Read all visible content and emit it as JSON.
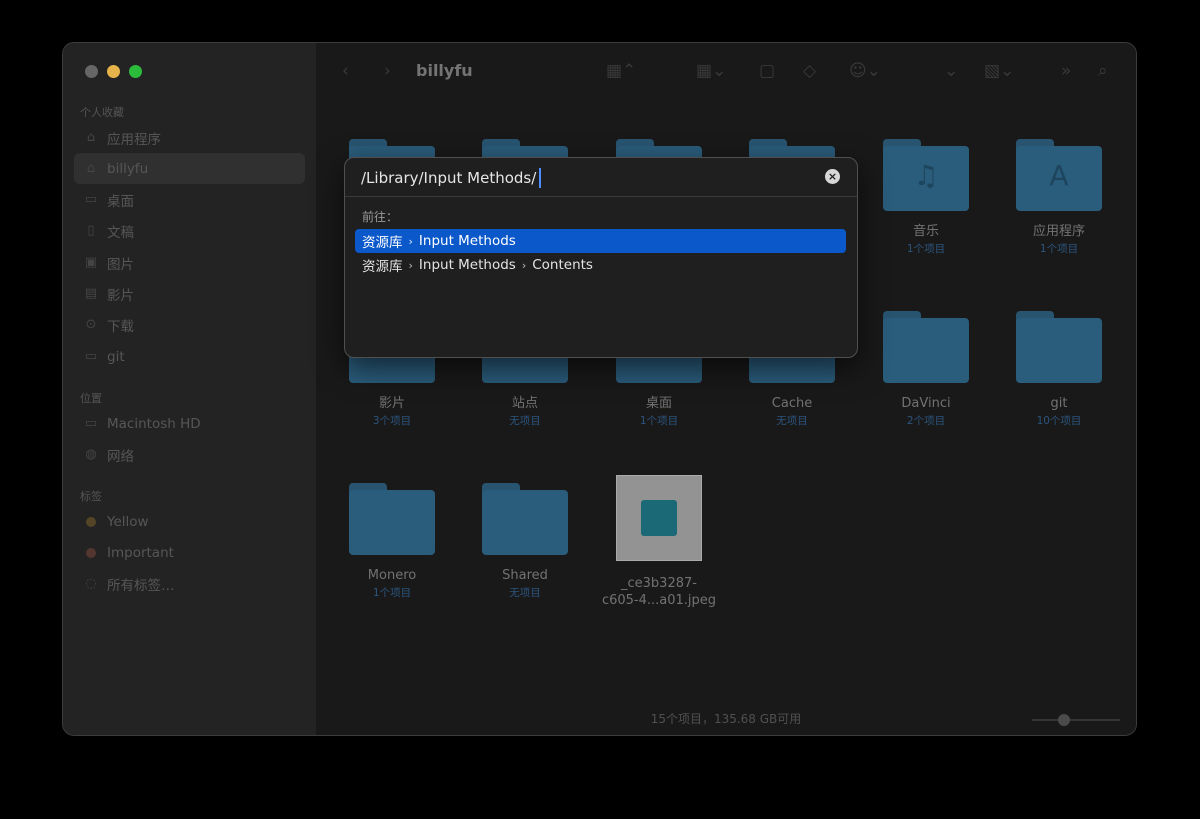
{
  "window": {
    "title": "billyfu"
  },
  "sidebar": {
    "favorites_heading": "个人收藏",
    "favorites": [
      {
        "label": "应用程序",
        "icon": "app-icon"
      },
      {
        "label": "billyfu",
        "icon": "home-icon"
      },
      {
        "label": "桌面",
        "icon": "desktop-icon"
      },
      {
        "label": "文稿",
        "icon": "document-icon"
      },
      {
        "label": "图片",
        "icon": "image-icon"
      },
      {
        "label": "影片",
        "icon": "movie-icon"
      },
      {
        "label": "下载",
        "icon": "download-icon"
      },
      {
        "label": "git",
        "icon": "folder-icon"
      }
    ],
    "locations_heading": "位置",
    "locations": [
      {
        "label": "Macintosh HD",
        "icon": "disk-icon"
      },
      {
        "label": "网络",
        "icon": "globe-icon"
      }
    ],
    "tags_heading": "标签",
    "tags": [
      {
        "label": "Yellow",
        "color": "#5a4a2a"
      },
      {
        "label": "Important",
        "color": "#5a3a33"
      },
      {
        "label": "所有标签…",
        "icon": "tag-icon"
      }
    ]
  },
  "items": [
    {
      "name": "音乐",
      "count": "1个项目",
      "glyph": "♫"
    },
    {
      "name": "应用程序",
      "count": "1个项目",
      "glyph": "A"
    },
    {
      "name": "影片",
      "count": "3个项目"
    },
    {
      "name": "站点",
      "count": "无项目"
    },
    {
      "name": "桌面",
      "count": "1个项目"
    },
    {
      "name": "Cache",
      "count": "无项目"
    },
    {
      "name": "DaVinci",
      "count": "2个项目"
    },
    {
      "name": "git",
      "count": "10个项目"
    },
    {
      "name": "Monero",
      "count": "1个项目"
    },
    {
      "name": "Shared",
      "count": "无项目"
    },
    {
      "name_line1": "_ce3b3287-",
      "name_line2": "c605-4...a01.jpeg"
    }
  ],
  "status": {
    "text": "15个项目，135.68 GB可用"
  },
  "dialog": {
    "path_value": "/Library/Input Methods/",
    "goto_label": "前往：",
    "suggestions": [
      {
        "parts": [
          "资源库",
          "Input Methods"
        ]
      },
      {
        "parts": [
          "资源库",
          "Input Methods",
          "Contents"
        ]
      }
    ]
  }
}
